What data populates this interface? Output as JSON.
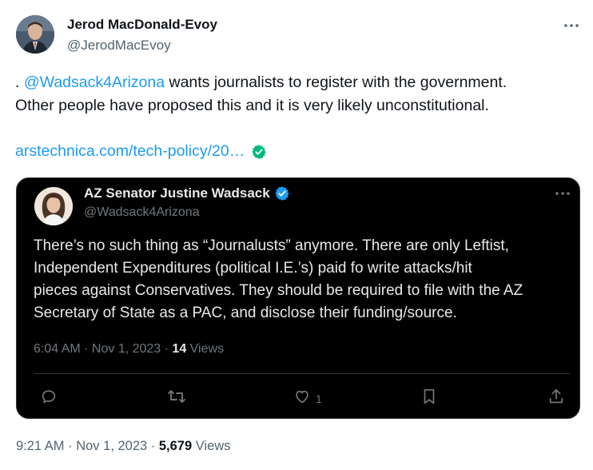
{
  "tweet": {
    "author": {
      "name": "Jerod MacDonald-Evoy",
      "handle": "@JerodMacEvoy"
    },
    "text_prefix": ". ",
    "mention": "@Wadsack4Arizona",
    "text_line1_rest": " wants journalists to register with the government.",
    "text_line2": "Other people have proposed this and it is very likely unconstitutional.",
    "link_text": "arstechnica.com/tech-policy/20…",
    "footer": {
      "time": "9:21 AM",
      "date": "Nov 1, 2023",
      "views_count": "5,679",
      "views_label": "Views"
    }
  },
  "quoted_tweet": {
    "author": {
      "name": "AZ Senator Justine Wadsack",
      "handle": "@Wadsack4Arizona"
    },
    "text_lines": [
      "There’s no such thing as “Journalusts” anymore. There are only Leftist,",
      "Independent Expenditures (political I.E.’s) paid fo write attacks/hit",
      "pieces against Conservatives. They should be required to file with the AZ",
      "Secretary of State as a PAC, and disclose their funding/source."
    ],
    "meta": {
      "time": "6:04 AM",
      "date": "Nov 1, 2023",
      "views_count": "14",
      "views_label": "Views"
    },
    "actions": {
      "reply": "",
      "retweet": "",
      "like": "1",
      "bookmark": "",
      "share": ""
    }
  },
  "separator": " · ",
  "icons": {
    "more": "more-horizontal-icon",
    "verified_link": "verified-check-green-icon",
    "verified_badge": "verified-badge-blue-icon",
    "reply": "reply-icon",
    "retweet": "retweet-icon",
    "like": "heart-icon",
    "bookmark": "bookmark-icon",
    "share": "share-icon"
  },
  "colors": {
    "link": "#1d9bf0",
    "verified_green": "#00ba7c",
    "verified_blue": "#1d9bf0",
    "dark_card": "#000000",
    "secondary_text": "#536471"
  }
}
